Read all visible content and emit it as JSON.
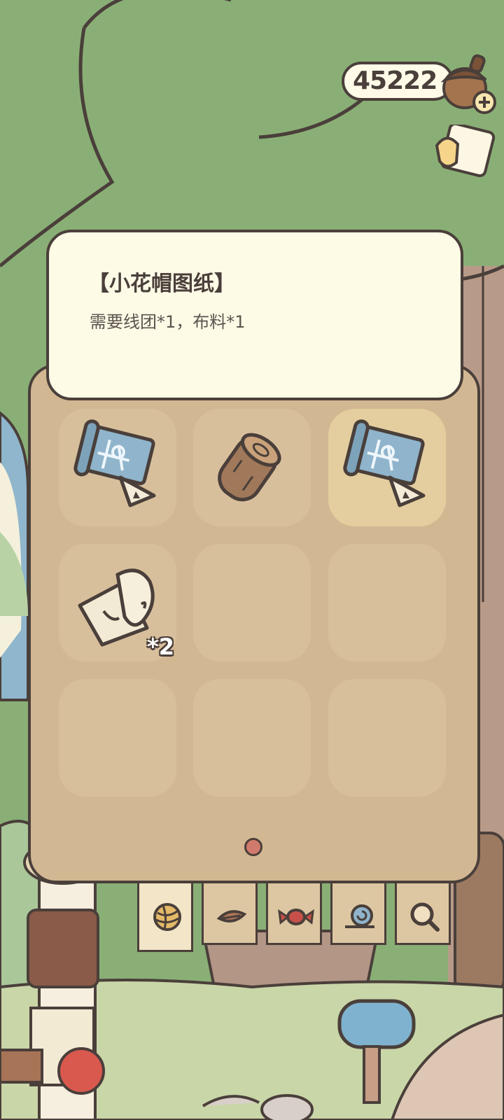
{
  "currency": {
    "clover_count": "45222",
    "acorn_icon": "acorn-plus-icon",
    "ticket_icon": "ticket-icon"
  },
  "tooltip": {
    "title": "【小花帽图纸】",
    "description": "需要线团*1，布料*1"
  },
  "inventory": {
    "slots": [
      {
        "item": "blueprint",
        "quantity": "",
        "selected": false
      },
      {
        "item": "wood-log",
        "quantity": "",
        "selected": false
      },
      {
        "item": "blueprint",
        "quantity": "",
        "selected": true
      },
      {
        "item": "cloth-roll",
        "quantity": "*2",
        "selected": false
      },
      {
        "item": "",
        "quantity": "",
        "selected": false
      },
      {
        "item": "",
        "quantity": "",
        "selected": false
      },
      {
        "item": "",
        "quantity": "",
        "selected": false
      },
      {
        "item": "",
        "quantity": "",
        "selected": false
      },
      {
        "item": "",
        "quantity": "",
        "selected": false
      }
    ],
    "page_count": 1,
    "current_page": 1
  },
  "tabs": [
    {
      "icon": "yarn-ball-icon",
      "active": true
    },
    {
      "icon": "leaf-icon",
      "active": false
    },
    {
      "icon": "candy-icon",
      "active": false
    },
    {
      "icon": "snail-icon",
      "active": false
    },
    {
      "icon": "magnifier-icon",
      "active": false
    }
  ],
  "colors": {
    "outline": "#4a3f3a",
    "panel": "#d2b793",
    "tooltip_bg": "#fdfae6",
    "tree": "#8aaf76",
    "dot": "#d07a6d"
  }
}
